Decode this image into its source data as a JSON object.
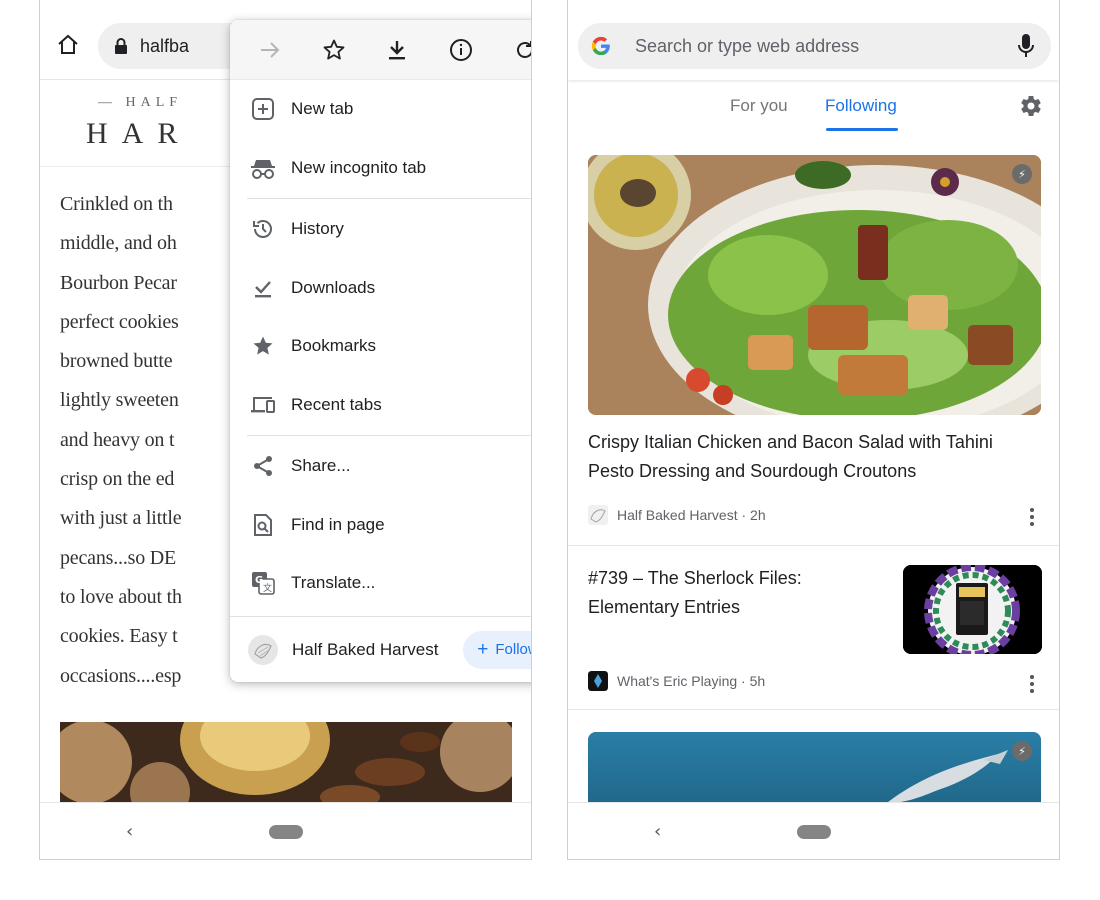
{
  "left_phone": {
    "omnibox": {
      "url_text": "halfba"
    },
    "site": {
      "logo_small": "— HALF",
      "logo_big": "HAR"
    },
    "article_lines": [
      "Crinkled on th",
      "middle, and oh",
      "Bourbon Pecar",
      "perfect cookies",
      "browned butte",
      "lightly sweeten",
      "and heavy on t",
      "crisp on the ed",
      "with just a little",
      "pecans...so DE",
      "to love about th",
      "cookies. Easy t",
      "occasions....esp"
    ],
    "menu": {
      "top_icons": [
        "forward-icon",
        "star-icon",
        "download-icon",
        "info-icon",
        "reload-icon"
      ],
      "group1": [
        {
          "label": "New tab",
          "icon": "new-tab-icon"
        },
        {
          "label": "New incognito tab",
          "icon": "incognito-icon"
        }
      ],
      "group2": [
        {
          "label": "History",
          "icon": "history-icon"
        },
        {
          "label": "Downloads",
          "icon": "downloads-icon"
        },
        {
          "label": "Bookmarks",
          "icon": "bookmarks-icon"
        },
        {
          "label": "Recent tabs",
          "icon": "recent-tabs-icon"
        }
      ],
      "group3": [
        {
          "label": "Share...",
          "icon": "share-icon"
        },
        {
          "label": "Find in page",
          "icon": "find-in-page-icon"
        },
        {
          "label": "Translate...",
          "icon": "translate-icon"
        }
      ],
      "footer": {
        "site_name": "Half Baked Harvest",
        "follow_plus": "+",
        "follow_label": "Follow"
      }
    },
    "nav": {
      "back": "‹"
    }
  },
  "right_phone": {
    "omnibox": {
      "placeholder": "Search or type web address"
    },
    "feed_tabs": {
      "for_you": "For you",
      "following": "Following",
      "active": "Following"
    },
    "cards": [
      {
        "title": "Crispy Italian Chicken and Bacon Salad with Tahini Pesto Dressing and Sourdough Croutons",
        "source": "Half Baked Harvest",
        "age": "2h",
        "source_line": "Half Baked Harvest · 2h"
      },
      {
        "title": "#739 – The Sherlock Files: Elementary Entries",
        "source": "What's Eric Playing",
        "age": "5h",
        "source_line": "What's Eric Playing · 5h"
      }
    ],
    "nav": {
      "back": "‹"
    }
  },
  "colors": {
    "accent": "#1a73e8",
    "follow_bg": "#e8f0fe",
    "omnibox_bg": "#efefef",
    "text_primary": "#202124",
    "text_secondary": "#5f6368"
  }
}
